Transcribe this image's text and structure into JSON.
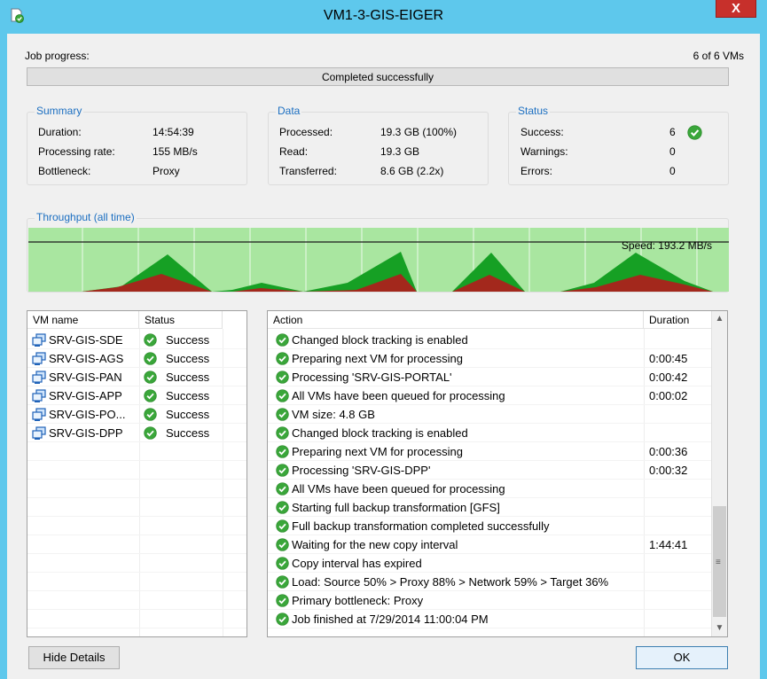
{
  "window": {
    "title": "VM1-3-GIS-EIGER",
    "close_label": "X"
  },
  "job": {
    "label": "Job progress:",
    "count": "6 of 6 VMs",
    "progress_text": "Completed successfully",
    "progress_percent": 100
  },
  "summary": {
    "legend": "Summary",
    "rows": [
      {
        "label": "Duration:",
        "value": "14:54:39"
      },
      {
        "label": "Processing rate:",
        "value": "155 MB/s"
      },
      {
        "label": "Bottleneck:",
        "value": "Proxy"
      }
    ]
  },
  "data": {
    "legend": "Data",
    "rows": [
      {
        "label": "Processed:",
        "value": "19.3 GB (100%)"
      },
      {
        "label": "Read:",
        "value": "19.3 GB"
      },
      {
        "label": "Transferred:",
        "value": "8.6 GB (2.2x)"
      }
    ]
  },
  "status": {
    "legend": "Status",
    "rows": [
      {
        "label": "Success:",
        "value": "6"
      },
      {
        "label": "Warnings:",
        "value": "0"
      },
      {
        "label": "Errors:",
        "value": "0"
      }
    ]
  },
  "throughput": {
    "legend": "Throughput (all time)",
    "speed": "Speed: 193.2 MB/s"
  },
  "vm_list": {
    "headers": {
      "name": "VM name",
      "status": "Status"
    },
    "rows": [
      {
        "name": "SRV-GIS-SDE",
        "status": "Success"
      },
      {
        "name": "SRV-GIS-AGS",
        "status": "Success"
      },
      {
        "name": "SRV-GIS-PAN",
        "status": "Success"
      },
      {
        "name": "SRV-GIS-APP",
        "status": "Success"
      },
      {
        "name": "SRV-GIS-PO...",
        "status": "Success"
      },
      {
        "name": "SRV-GIS-DPP",
        "status": "Success"
      }
    ]
  },
  "action_list": {
    "headers": {
      "action": "Action",
      "duration": "Duration"
    },
    "rows": [
      {
        "action": "Changed block tracking is enabled",
        "duration": ""
      },
      {
        "action": "Preparing next VM for processing",
        "duration": "0:00:45"
      },
      {
        "action": "Processing 'SRV-GIS-PORTAL'",
        "duration": "0:00:42"
      },
      {
        "action": "All VMs have been queued for processing",
        "duration": "0:00:02"
      },
      {
        "action": "VM size: 4.8 GB",
        "duration": ""
      },
      {
        "action": "Changed block tracking is enabled",
        "duration": ""
      },
      {
        "action": "Preparing next VM for processing",
        "duration": "0:00:36"
      },
      {
        "action": "Processing 'SRV-GIS-DPP'",
        "duration": "0:00:32"
      },
      {
        "action": "All VMs have been queued for processing",
        "duration": ""
      },
      {
        "action": "Starting full backup transformation [GFS]",
        "duration": ""
      },
      {
        "action": "Full backup transformation completed successfully",
        "duration": ""
      },
      {
        "action": "Waiting for the new copy interval",
        "duration": "1:44:41"
      },
      {
        "action": "Copy interval has expired",
        "duration": ""
      },
      {
        "action": "Load: Source 50% > Proxy 88% > Network 59% > Target 36%",
        "duration": ""
      },
      {
        "action": "Primary bottleneck: Proxy",
        "duration": ""
      },
      {
        "action": "Job finished at 7/29/2014 11:00:04 PM",
        "duration": ""
      }
    ]
  },
  "buttons": {
    "hide_details": "Hide Details",
    "ok": "OK"
  },
  "colors": {
    "accent": "#1c6fc1",
    "success": "#3aa63a",
    "chart_bg": "#a9e6a0",
    "chart_green": "#16a024",
    "chart_red": "#a3281c"
  },
  "icons": {
    "app": "job-check-icon",
    "vm": "vm-icon",
    "status_ok": "check-circle-icon"
  }
}
